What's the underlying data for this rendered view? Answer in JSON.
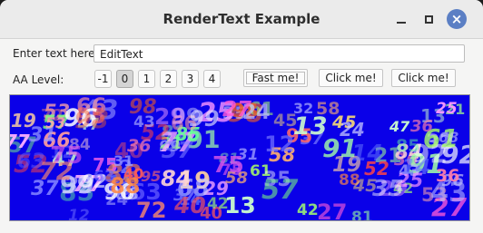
{
  "window": {
    "title": "RenderText Example",
    "controls": {
      "minimize": "minimize-icon",
      "maximize": "maximize-icon",
      "close": "close-icon"
    }
  },
  "form": {
    "text_label": "Enter text here:",
    "text_value": "EditText",
    "aa_label": "AA Level:",
    "aa_levels": [
      "-1",
      "0",
      "1",
      "2",
      "3",
      "4"
    ],
    "aa_selected": "0"
  },
  "buttons": {
    "fast": "Fast me!",
    "click1": "Click me!",
    "click2": "Click me!"
  },
  "canvas": {
    "background": "#0a00e8",
    "glyphs": [
      [
        "75",
        "#d855e8"
      ],
      [
        "98",
        "#e85a2a"
      ],
      [
        "63",
        "#6a63ff"
      ],
      [
        "14",
        "#6a7cff"
      ],
      [
        "43",
        "#b5b5ff"
      ],
      [
        "40",
        "#ff5a5a"
      ],
      [
        "37",
        "#8080ff"
      ],
      [
        "12",
        "#7a7aff"
      ],
      [
        "99",
        "#e0e0ff"
      ],
      [
        "36",
        "#ff7faa"
      ],
      [
        "88",
        "#ff8844"
      ],
      [
        "53",
        "#ffa7a7"
      ],
      [
        "32",
        "#cfd0ff"
      ],
      [
        "21",
        "#a4ff8c"
      ],
      [
        "45",
        "#ffe070"
      ],
      [
        "27",
        "#ff5ad8"
      ],
      [
        "61",
        "#aaff66"
      ],
      [
        "19",
        "#ffd0a0"
      ],
      [
        "57",
        "#7cff7c"
      ],
      [
        "92",
        "#ffffff"
      ],
      [
        "85",
        "#66ff99"
      ],
      [
        "77",
        "#ffb0ff"
      ],
      [
        "24",
        "#c9c9ff"
      ],
      [
        "52",
        "#ff4444"
      ],
      [
        "35",
        "#ffffff"
      ],
      [
        "81",
        "#8ae6a6"
      ],
      [
        "66",
        "#ff9c9c"
      ],
      [
        "47",
        "#cfffcf"
      ],
      [
        "29",
        "#f0a0ff"
      ],
      [
        "95",
        "#ff6a6a"
      ],
      [
        "72",
        "#ff8c6a"
      ],
      [
        "58",
        "#ffb070"
      ],
      [
        "31",
        "#9d9dff"
      ],
      [
        "13",
        "#d0ffcc"
      ],
      [
        "84",
        "#ffd6d6"
      ],
      [
        "91",
        "#a5ffa5"
      ],
      [
        "25",
        "#ff9aff"
      ],
      [
        "68",
        "#c8c8ff"
      ],
      [
        "42",
        "#a4ff6f"
      ],
      [
        "96",
        "#ffffff"
      ]
    ]
  }
}
